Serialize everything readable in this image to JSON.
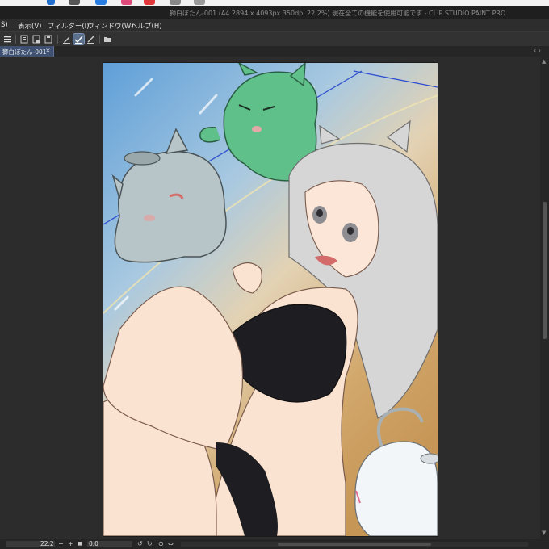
{
  "app": {
    "window_title": "獅白ぼたん-001 (A4 2894 x 4093px 350dpi 22.2%)  現在全ての機能を使用可能です - CLIP STUDIO PAINT PRO"
  },
  "menu": {
    "items": [
      {
        "label": "S)"
      },
      {
        "label": "表示(V)"
      },
      {
        "label": "フィルター(I)"
      },
      {
        "label": "ウィンドウ(W)"
      },
      {
        "label": "ヘルプ(H)"
      }
    ]
  },
  "tabs": {
    "active": {
      "label": "獅白ぼたん-001",
      "close": "×"
    },
    "arrows": "‹ ›"
  },
  "status": {
    "zoom": "22.2",
    "rotation": "0.0",
    "zoom_out": "−",
    "zoom_in": "+",
    "fit": "■"
  },
  "colors": {
    "accent": "#5a6f8c",
    "tab_active": "#3f5170",
    "background": "#2a2a2a"
  },
  "icons": {
    "hamburger": "menu-icon",
    "new": "new-canvas-icon",
    "open": "open-file-icon",
    "save": "save-icon",
    "pen": "pen-icon",
    "check": "check-icon",
    "draw": "draw-icon",
    "folder": "folder-icon"
  }
}
